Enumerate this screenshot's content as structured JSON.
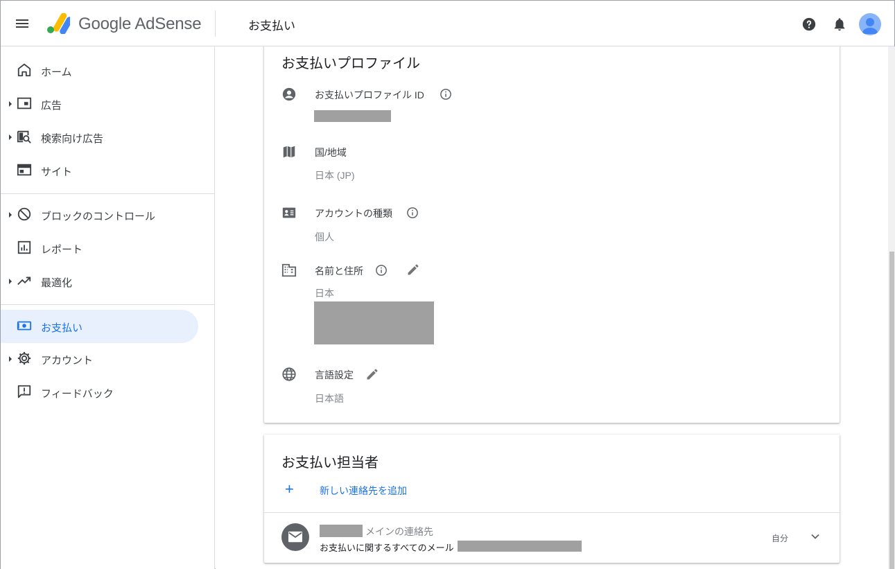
{
  "header": {
    "logo_text": "Google AdSense",
    "page_title": "お支払い"
  },
  "sidebar": {
    "items": [
      {
        "label": "ホーム",
        "icon": "home-icon"
      },
      {
        "label": "広告",
        "icon": "ads-icon"
      },
      {
        "label": "検索向け広告",
        "icon": "search-ads-icon"
      },
      {
        "label": "サイト",
        "icon": "sites-icon"
      },
      {
        "label": "ブロックのコントロール",
        "icon": "block-icon"
      },
      {
        "label": "レポート",
        "icon": "report-icon"
      },
      {
        "label": "最適化",
        "icon": "trending-icon"
      },
      {
        "label": "お支払い",
        "icon": "payments-icon",
        "active": true
      },
      {
        "label": "アカウント",
        "icon": "gear-icon"
      },
      {
        "label": "フィードバック",
        "icon": "feedback-icon"
      }
    ]
  },
  "profile_card": {
    "title": "お支払いプロファイル",
    "profile_id_label": "お支払いプロファイル ID",
    "country_label": "国/地域",
    "country_value": "日本 (JP)",
    "account_type_label": "アカウントの種類",
    "account_type_value": "個人",
    "name_address_label": "名前と住所",
    "name_address_value": "日本",
    "language_label": "言語設定",
    "language_value": "日本語"
  },
  "contacts_card": {
    "title": "お支払い担当者",
    "add_label": "新しい連絡先を追加",
    "contact_role": "メインの連絡先",
    "contact_sub": "お支払いに関するすべてのメール",
    "contact_self": "自分"
  },
  "colors": {
    "accent": "#1a73e8",
    "active_bg": "#e8f0fe",
    "redaction": "#a0a0a0"
  }
}
